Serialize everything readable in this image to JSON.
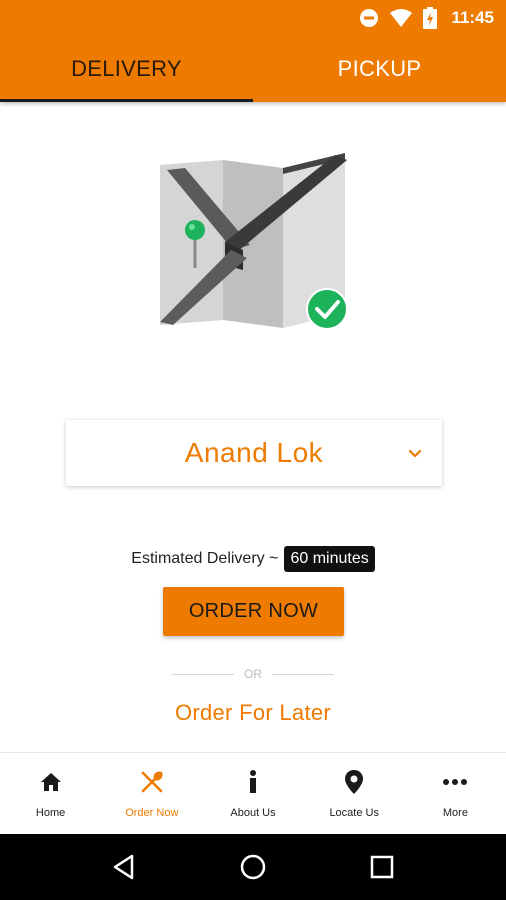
{
  "status_bar": {
    "time": "11:45",
    "icons": [
      "do-not-disturb-icon",
      "wifi-icon",
      "battery-charging-icon"
    ]
  },
  "tabs": [
    {
      "label": "DELIVERY",
      "active": true
    },
    {
      "label": "PICKUP",
      "active": false
    }
  ],
  "location": {
    "selected": "Anand Lok"
  },
  "estimate": {
    "label": "Estimated Delivery ~",
    "value": "60 minutes"
  },
  "order_button": {
    "label": "ORDER NOW"
  },
  "or_divider": {
    "label": "OR"
  },
  "order_later": {
    "label": "Order For Later"
  },
  "bottom_nav": [
    {
      "label": "Home",
      "icon": "home-icon",
      "active": false
    },
    {
      "label": "Order Now",
      "icon": "fork-spoon-icon",
      "active": true
    },
    {
      "label": "About Us",
      "icon": "info-icon",
      "active": false
    },
    {
      "label": "Locate Us",
      "icon": "location-pin-icon",
      "active": false
    },
    {
      "label": "More",
      "icon": "more-icon",
      "active": false
    }
  ],
  "colors": {
    "accent": "#ee7a00",
    "success": "#1db35a",
    "dark": "#1a1a1a"
  }
}
